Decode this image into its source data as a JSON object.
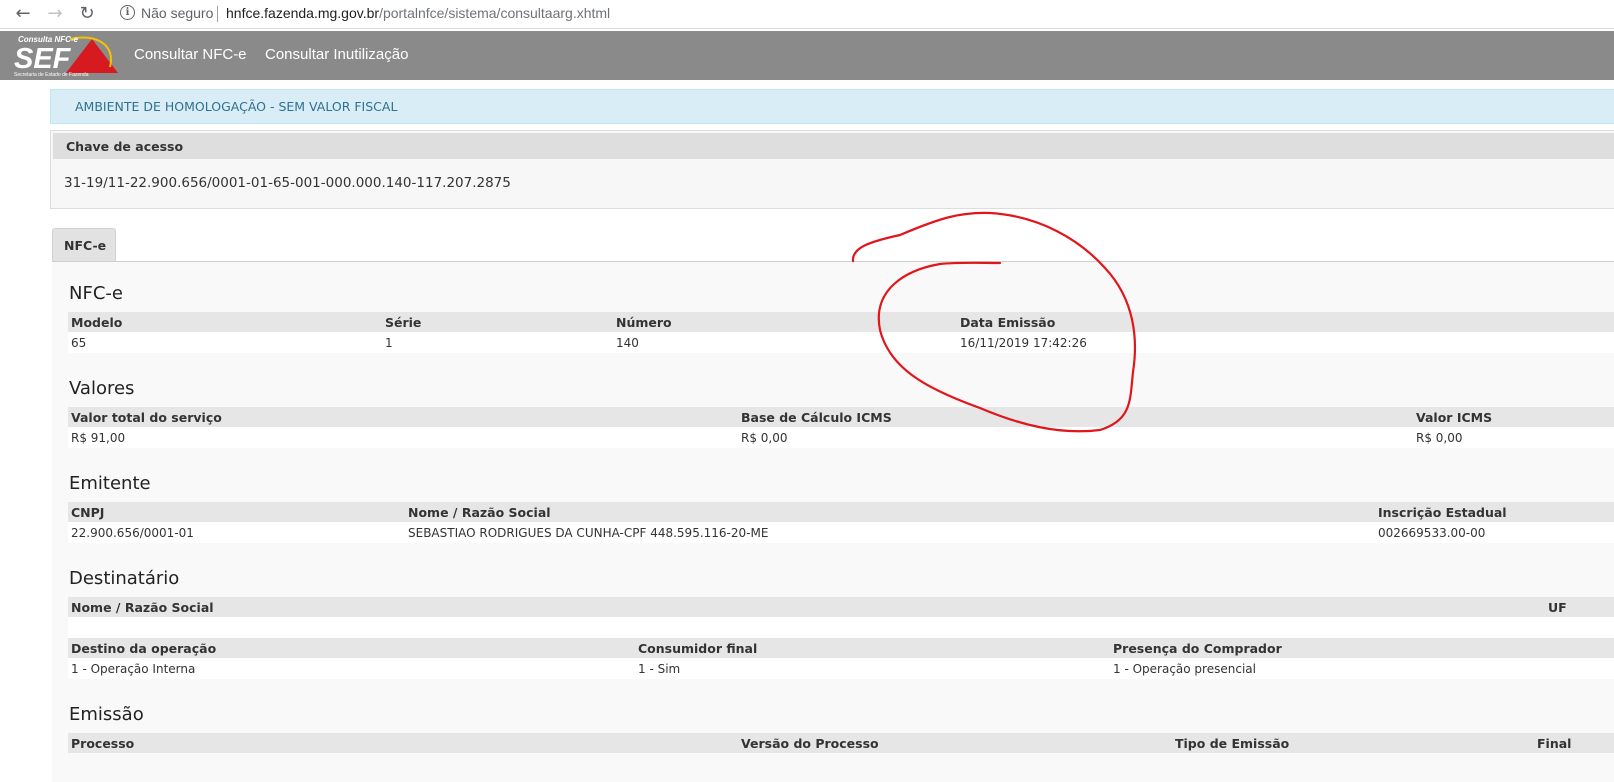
{
  "browser": {
    "insecure_label": "Não seguro",
    "url_host": "hnfce.fazenda.mg.gov.br",
    "url_path": "/portalnfce/sistema/consultaarg.xhtml"
  },
  "header": {
    "logo_top": "Consulta NFC-e",
    "logo_main": "SEF",
    "logo_sub": "Secretaria de Estado de Fazenda",
    "menu": [
      "Consultar NFC-e",
      "Consultar Inutilização"
    ]
  },
  "alert": "AMBIENTE DE HOMOLOGAÇÃO - SEM VALOR FISCAL",
  "chave": {
    "label": "Chave de acesso",
    "value": "31-19/11-22.900.656/0001-01-65-001-000.000.140-117.207.2875"
  },
  "tab_label": "NFC-e",
  "nfce": {
    "title": "NFC-e",
    "headers": [
      "Modelo",
      "Série",
      "Número",
      "Data Emissão"
    ],
    "values": [
      "65",
      "1",
      "140",
      "16/11/2019 17:42:26"
    ]
  },
  "valores": {
    "title": "Valores",
    "headers": [
      "Valor total do serviço",
      "Base de Cálculo ICMS",
      "Valor ICMS"
    ],
    "values": [
      "R$ 91,00",
      "R$ 0,00",
      "R$ 0,00"
    ]
  },
  "emitente": {
    "title": "Emitente",
    "headers": [
      "CNPJ",
      "Nome / Razão Social",
      "Inscrição Estadual"
    ],
    "values": [
      "22.900.656/0001-01",
      "SEBASTIAO RODRIGUES DA CUNHA-CPF 448.595.116-20-ME",
      "002669533.00-00"
    ]
  },
  "destinatario": {
    "title": "Destinatário",
    "headers1": [
      "Nome / Razão Social",
      "UF"
    ],
    "headers2": [
      "Destino da operação",
      "Consumidor final",
      "Presença do Comprador"
    ],
    "values2": [
      "1 - Operação Interna",
      "1 - Sim",
      "1 - Operação presencial"
    ]
  },
  "emissao": {
    "title": "Emissão",
    "headers": [
      "Processo",
      "Versão do Processo",
      "Tipo de Emissão",
      "Final"
    ]
  },
  "colors": {
    "topbar": "#8a8a8a",
    "alert_bg": "#d9edf7",
    "alert_text": "#31708f",
    "annotation": "#e0161b"
  }
}
